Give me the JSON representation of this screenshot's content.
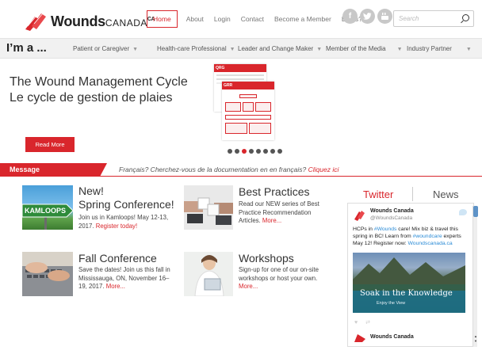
{
  "header": {
    "logo_text": "Wounds",
    "logo_suffix": "CANADA",
    "logo_sup": "CA",
    "nav": [
      "Home",
      "About",
      "Login",
      "Contact",
      "Become a Member",
      "Blogs?"
    ],
    "social": [
      "f",
      "t",
      "yt"
    ],
    "search_placeholder": "Search"
  },
  "audience": {
    "label": "I’m a ...",
    "items": [
      "Patient or Caregiver",
      "Health-care Professional",
      "Leader and Change Maker",
      "Member of the Media",
      "Industry Partner"
    ]
  },
  "hero": {
    "title_en": "The Wound Management Cycle",
    "title_fr": "Le cycle de gestion de plaies",
    "button": "Read More",
    "doc_labels": [
      "QRG",
      "GRR"
    ],
    "slide_count": 8,
    "active_slide": 2
  },
  "message": {
    "label": "Message",
    "text": "Français? Cherchez-vous de la documentation en en français?",
    "link": "Cliquez ici"
  },
  "cards": {
    "spring": {
      "title1": "New!",
      "title2": "Spring Conference!",
      "text": "Join us in Kamloops! May 12-13, 2017.",
      "link": "Register today!",
      "sign": "KAMLOOPS"
    },
    "best": {
      "title": "Best Practices",
      "text": "Read our NEW series of Best Practice Recommendation Articles.",
      "link": "More..."
    },
    "fall": {
      "title": "Fall Conference",
      "text": "Save the dates! Join us this fall in Mississauga, ON, November 16–19, 2017.",
      "link": "More..."
    },
    "workshops": {
      "title": "Workshops",
      "text": "Sign-up for one of our on-site workshops or host your own.",
      "link": "More..."
    }
  },
  "social_panel": {
    "tab_twitter": "Twitter",
    "tab_news": "News",
    "account_name": "Wounds Canada",
    "account_handle": "@WoundsCanada",
    "tweet_parts": [
      "HCPs in ",
      "#Wounds",
      " care! Mix biz & travel this spring in BC! Learn from ",
      "#woundcare",
      " experts May 12! Register now: ",
      "Woundscanada.ca"
    ],
    "photo_caption": "Soak in the Knowledge",
    "photo_sub": "Enjoy the View",
    "footer_name": "Wounds Canada"
  },
  "colors": {
    "brand_red": "#d9262c",
    "twitter_blue": "#2a8bd6"
  }
}
